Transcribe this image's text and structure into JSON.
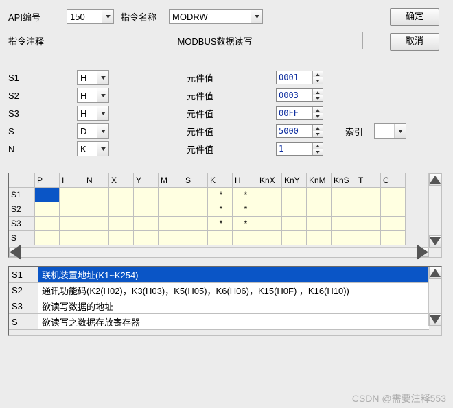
{
  "header": {
    "api_num_label": "API编号",
    "api_num_value": "150",
    "instr_name_label": "指令名称",
    "instr_name_value": "MODRW",
    "btn_ok": "确定",
    "btn_cancel": "取消",
    "comment_label": "指令注释",
    "comment_value": "MODBUS数据读写"
  },
  "params": [
    {
      "name": "S1",
      "type": "H",
      "vlabel": "元件值",
      "value": "0001",
      "show_index": false
    },
    {
      "name": "S2",
      "type": "H",
      "vlabel": "元件值",
      "value": "0003",
      "show_index": false
    },
    {
      "name": "S3",
      "type": "H",
      "vlabel": "元件值",
      "value": "00FF",
      "show_index": false
    },
    {
      "name": "S",
      "type": "D",
      "vlabel": "元件值",
      "value": "5000",
      "show_index": true,
      "index_label": "索引",
      "index_value": ""
    },
    {
      "name": "N",
      "type": "K",
      "vlabel": "元件值",
      "value": "1",
      "show_index": false
    }
  ],
  "grid": {
    "cols": [
      "P",
      "I",
      "N",
      "X",
      "Y",
      "M",
      "S",
      "K",
      "H",
      "KnX",
      "KnY",
      "KnM",
      "KnS",
      "T",
      "C"
    ],
    "rows": [
      {
        "hdr": "S1",
        "marks": {
          "K": "*",
          "H": "*"
        },
        "selcol": "P"
      },
      {
        "hdr": "S2",
        "marks": {
          "K": "*",
          "H": "*"
        }
      },
      {
        "hdr": "S3",
        "marks": {
          "K": "*",
          "H": "*"
        }
      },
      {
        "hdr": "S",
        "marks": {}
      }
    ]
  },
  "desc": [
    {
      "hdr": "S1",
      "text": "联机装置地址(K1~K254)",
      "sel": true
    },
    {
      "hdr": "S2",
      "text": "通讯功能码(K2(H02)，K3(H03)，K5(H05)，K6(H06)，K15(H0F) ，K16(H10))",
      "sel": false
    },
    {
      "hdr": "S3",
      "text": "欲读写数据的地址",
      "sel": false
    },
    {
      "hdr": "S",
      "text": "欲读写之数据存放寄存器",
      "sel": false
    }
  ],
  "watermark": "CSDN @需要注释553"
}
